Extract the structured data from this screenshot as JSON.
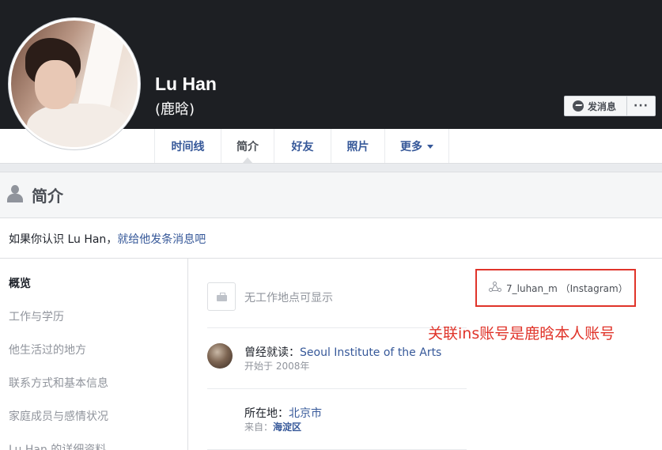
{
  "profile": {
    "name": "Lu Han",
    "subname": "(鹿晗)"
  },
  "actions": {
    "message_label": "发消息",
    "more_label": "···"
  },
  "tabs": [
    {
      "label": "时间线",
      "active": false
    },
    {
      "label": "简介",
      "active": true
    },
    {
      "label": "好友",
      "active": false
    },
    {
      "label": "照片",
      "active": false
    },
    {
      "label": "更多",
      "active": false
    }
  ],
  "about": {
    "title": "简介",
    "hint_prefix": "如果你认识 Lu Han，",
    "hint_link": "就给他发条消息吧"
  },
  "sidebar": {
    "items": [
      {
        "label": "概览",
        "active": true
      },
      {
        "label": "工作与学历",
        "active": false
      },
      {
        "label": "他生活过的地方",
        "active": false
      },
      {
        "label": "联系方式和基本信息",
        "active": false
      },
      {
        "label": "家庭成员与感情状况",
        "active": false
      },
      {
        "label": "Lu Han 的详细资料",
        "active": false
      }
    ]
  },
  "overview": {
    "work": "无工作地点可显示",
    "school_prefix": "曾经就读：",
    "school_name": "Seoul Institute of the Arts",
    "school_since": "开始于 2008年",
    "location_prefix": "所在地：",
    "location_city": "北京市",
    "from_prefix": "来自：",
    "from_place": "海淀区"
  },
  "social": {
    "instagram_text": "7_luhan_m （Instagram）"
  },
  "annotation": {
    "text": "关联ins账号是鹿晗本人账号",
    "color": "#e0342a"
  },
  "colors": {
    "link": "#365899",
    "cover": "#1d1f23",
    "highlight": "#e0342a"
  }
}
